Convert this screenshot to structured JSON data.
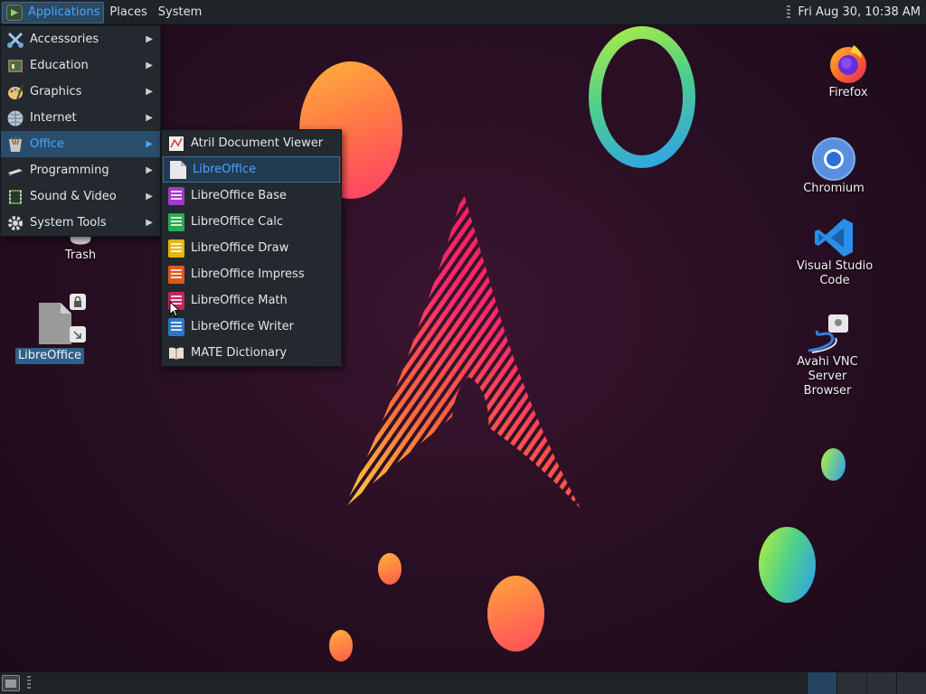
{
  "top_panel": {
    "applications_label": "Applications",
    "places_label": "Places",
    "system_label": "System",
    "clock": "Fri Aug 30, 10:38 AM"
  },
  "app_menu": {
    "items": [
      {
        "label": "Accessories",
        "icon": "accessories-icon"
      },
      {
        "label": "Education",
        "icon": "education-icon"
      },
      {
        "label": "Graphics",
        "icon": "graphics-icon"
      },
      {
        "label": "Internet",
        "icon": "internet-icon"
      },
      {
        "label": "Office",
        "icon": "office-icon",
        "active": true
      },
      {
        "label": "Programming",
        "icon": "programming-icon"
      },
      {
        "label": "Sound & Video",
        "icon": "sound-video-icon"
      },
      {
        "label": "System Tools",
        "icon": "system-tools-icon"
      }
    ]
  },
  "office_submenu": {
    "items": [
      {
        "label": "Atril Document Viewer",
        "icon": "atril-icon"
      },
      {
        "label": "LibreOffice",
        "icon": "libreoffice-icon",
        "hover": true
      },
      {
        "label": "LibreOffice Base",
        "icon": "libreoffice-base-icon",
        "color": "#a33bc6"
      },
      {
        "label": "LibreOffice Calc",
        "icon": "libreoffice-calc-icon",
        "color": "#2fa84f"
      },
      {
        "label": "LibreOffice Draw",
        "icon": "libreoffice-draw-icon",
        "color": "#e8b40f"
      },
      {
        "label": "LibreOffice Impress",
        "icon": "libreoffice-impress-icon",
        "color": "#e2561b"
      },
      {
        "label": "LibreOffice Math",
        "icon": "libreoffice-math-icon",
        "color": "#c4255a"
      },
      {
        "label": "LibreOffice Writer",
        "icon": "libreoffice-writer-icon",
        "color": "#2b78c4"
      },
      {
        "label": "MATE Dictionary",
        "icon": "dictionary-icon"
      }
    ]
  },
  "desktop_icons": {
    "trash": "Trash",
    "libreoffice": "LibreOffice",
    "firefox": "Firefox",
    "chromium": "Chromium",
    "vscode": "Visual Studio Code",
    "avahi_line1": "Avahi VNC Server",
    "avahi_line2": "Browser"
  },
  "colors": {
    "accent": "#4aa3ff",
    "panel": "#1f2429",
    "menu_bg": "#23292e"
  }
}
